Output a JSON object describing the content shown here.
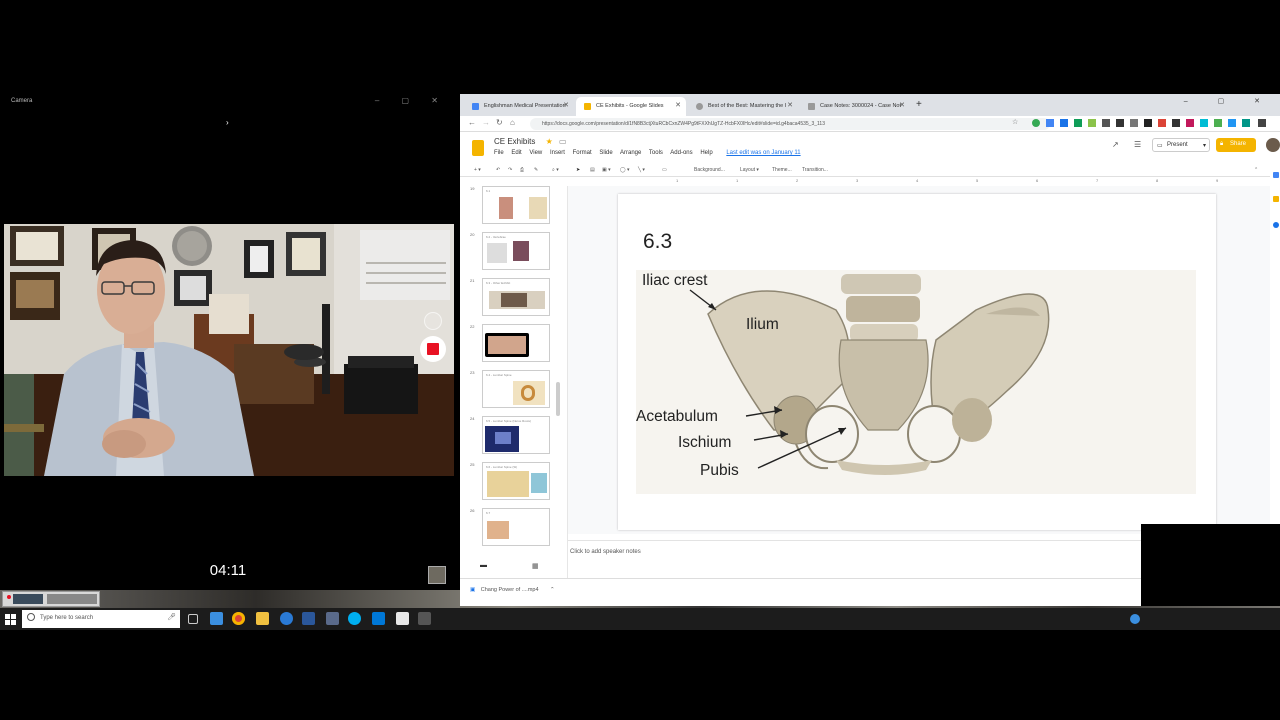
{
  "camera": {
    "title": "Camera",
    "timer": "04:11"
  },
  "browser": {
    "tabs": [
      {
        "label": "Englishman Medical Presentation",
        "color": "#4285f4",
        "active": false
      },
      {
        "label": "CE Exhibits - Google Slides",
        "color": "#f4b400",
        "active": true
      },
      {
        "label": "Best of the Best: Mastering the I",
        "color": "#999999",
        "active": false
      },
      {
        "label": "Case Notes: 3000024 - Case Not",
        "color": "#999999",
        "active": false
      }
    ],
    "url": "https://docs.google.com/presentation/d/1fN8B3ctjXtuRCbCxnZW4Pg9tFXXhUgTZ-HcbFX0IHc/edit#slide=id.g4baca4535_3_113"
  },
  "slides": {
    "doc_title": "CE Exhibits",
    "menu": [
      "File",
      "Edit",
      "View",
      "Insert",
      "Format",
      "Slide",
      "Arrange",
      "Tools",
      "Add-ons",
      "Help"
    ],
    "last_edit": "Last edit was on January 11",
    "present_label": "Present",
    "share_label": "Share",
    "toolbar": {
      "background": "Background...",
      "layout": "Layout ▾",
      "theme": "Theme...",
      "transition": "Transition..."
    },
    "ruler_ticks": [
      "1",
      "1",
      "2",
      "3",
      "4",
      "5",
      "6",
      "7",
      "8",
      "9"
    ],
    "thumbnails": [
      {
        "num": "19",
        "title": "6.1",
        "colors": [
          "#c98f7d",
          "#e8d9b6"
        ]
      },
      {
        "num": "20",
        "title": "6.2 - Vertebrae",
        "colors": [
          "#ccc",
          "#7a4d5c"
        ]
      },
      {
        "num": "21",
        "title": "6.3 - Other Exhibit",
        "colors": [
          "#6e5a4a",
          "#d9d0c0"
        ]
      },
      {
        "num": "22",
        "title": "",
        "colors": [
          "#d1a58c",
          "#000"
        ]
      },
      {
        "num": "23",
        "title": "6.4 - Lumbar Spine",
        "colors": [
          "#e0b25f",
          "#c78a3c"
        ]
      },
      {
        "num": "24",
        "title": "6.5 - Lumbar Spine (Nerve Roots)",
        "colors": [
          "#1e2a6b",
          "#6d7fc9"
        ]
      },
      {
        "num": "25",
        "title": "6.6 - Lumbar Spine (SI)",
        "colors": [
          "#e8d29a",
          "#8fc6d8"
        ]
      },
      {
        "num": "26",
        "title": "6.7",
        "colors": [
          "#e0b28c",
          "#e8d0b0"
        ]
      }
    ],
    "slide_number": "6.3",
    "labels": {
      "iliac_crest": "Iliac crest",
      "ilium": "Ilium",
      "acetabulum": "Acetabulum",
      "ischium": "Ischium",
      "pubis": "Pubis"
    },
    "notes_placeholder": "Click to add speaker notes"
  },
  "downloads": {
    "file": "Chang Power of ....mp4"
  },
  "taskbar": {
    "search_placeholder": "Type here to search"
  }
}
